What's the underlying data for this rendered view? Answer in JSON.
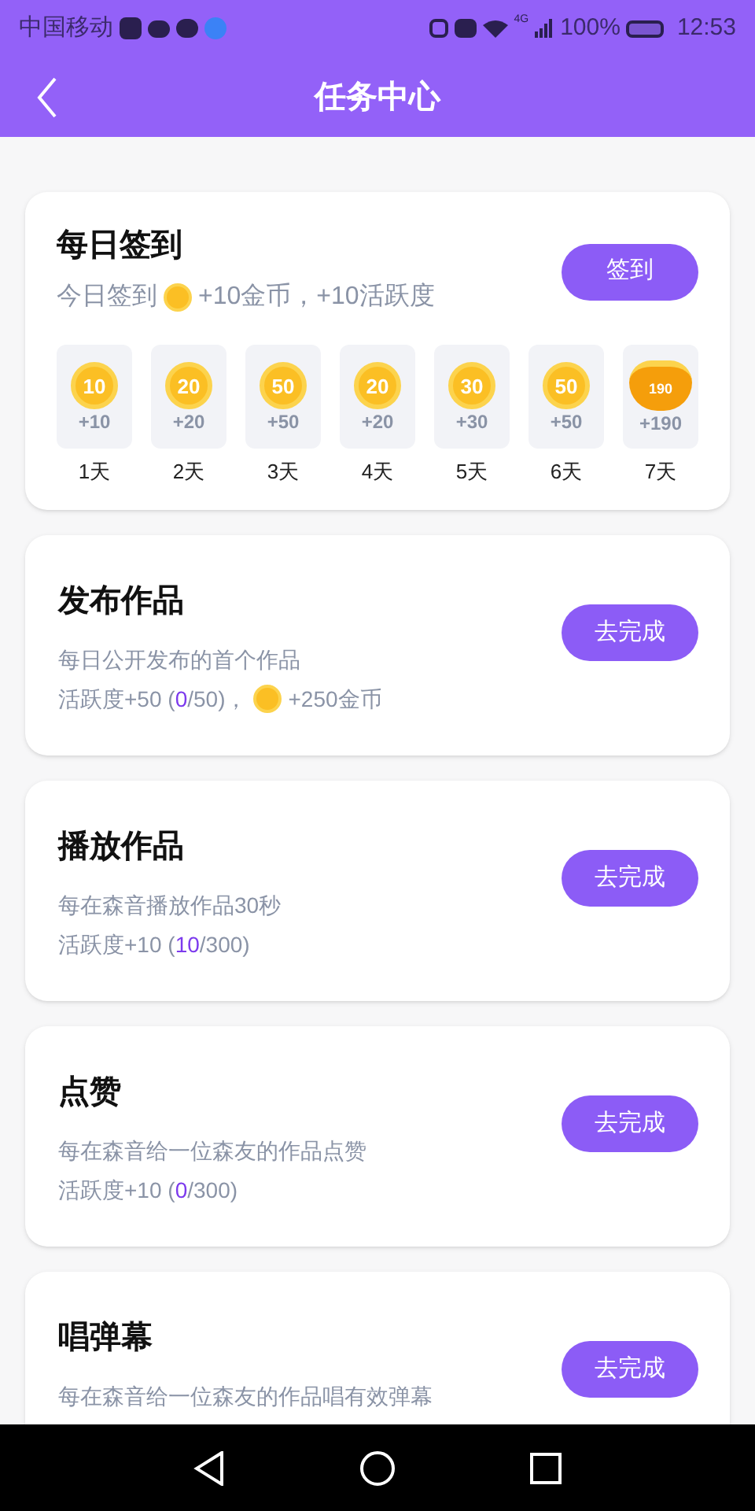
{
  "status_bar": {
    "carrier": "中国移动",
    "network": "4G",
    "battery": "100%",
    "time": "12:53"
  },
  "header": {
    "title": "任务中心"
  },
  "checkin": {
    "title": "每日签到",
    "subtitle_before": "今日签到",
    "subtitle_after": "+10金币，+10活跃度",
    "button": "签到",
    "days": [
      {
        "kind": "coin",
        "coin_label": "10",
        "reward": "+10",
        "day": "1天"
      },
      {
        "kind": "coin",
        "coin_label": "20",
        "reward": "+20",
        "day": "2天"
      },
      {
        "kind": "coin",
        "coin_label": "50",
        "reward": "+50",
        "day": "3天"
      },
      {
        "kind": "coin",
        "coin_label": "20",
        "reward": "+20",
        "day": "4天"
      },
      {
        "kind": "coin",
        "coin_label": "30",
        "reward": "+30",
        "day": "5天"
      },
      {
        "kind": "coin",
        "coin_label": "50",
        "reward": "+50",
        "day": "6天"
      },
      {
        "kind": "bag",
        "coin_label": "190",
        "reward": "+190",
        "day": "7天"
      }
    ]
  },
  "tasks": [
    {
      "title": "发布作品",
      "description": "每日公开发布的首个作品",
      "progress_before": "活跃度+50 (",
      "progress_done": "0",
      "progress_after": "/50)，",
      "coin_reward": "+250金币",
      "button": "去完成"
    },
    {
      "title": "播放作品",
      "description": "每在森音播放作品30秒",
      "progress_before": "活跃度+10 (",
      "progress_done": "10",
      "progress_after": "/300)",
      "button": "去完成"
    },
    {
      "title": "点赞",
      "description": "每在森音给一位森友的作品点赞",
      "progress_before": "活跃度+10 (",
      "progress_done": "0",
      "progress_after": "/300)",
      "button": "去完成"
    },
    {
      "title": "唱弹幕",
      "description": "每在森音给一位森友的作品唱有效弹幕",
      "button": "去完成"
    }
  ]
}
